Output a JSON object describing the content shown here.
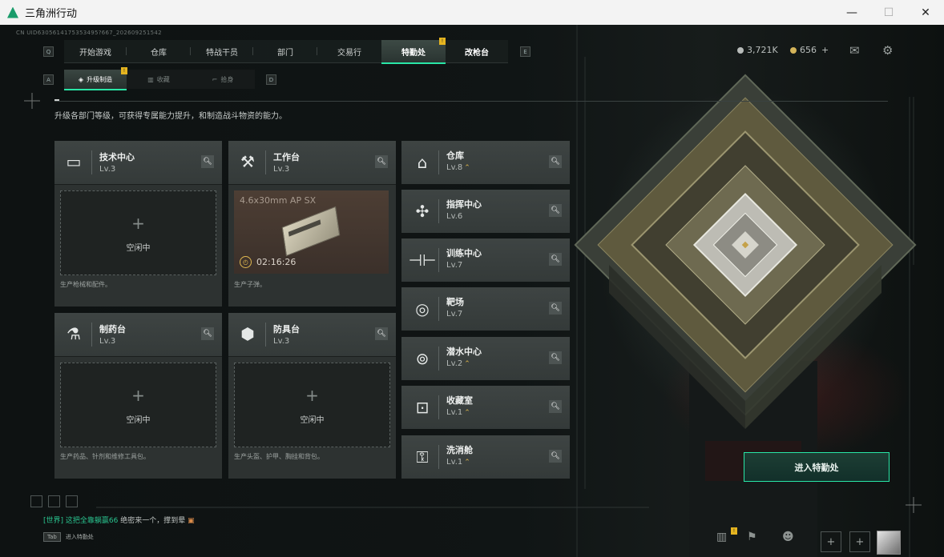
{
  "window": {
    "title": "三角洲行动",
    "minimize": "—",
    "maximize": "☐",
    "close": "✕"
  },
  "uid": "CN UID6305614175353495?667_202609251542",
  "nav": {
    "left_key": "Q",
    "right_key": "E",
    "tabs": [
      {
        "label": "开始游戏",
        "width": 78
      },
      {
        "label": "仓库",
        "width": 80
      },
      {
        "label": "特战干员",
        "width": 78
      },
      {
        "label": "部门",
        "width": 80
      },
      {
        "label": "交易行",
        "width": 80
      },
      {
        "label": "特勤处",
        "width": 80
      },
      {
        "label": "改枪台",
        "width": 78
      }
    ]
  },
  "currency": {
    "coins": "3,721K",
    "tokens": "656",
    "add": "+"
  },
  "subnav": {
    "left_key": "A",
    "right_key": "D",
    "tabs": [
      {
        "label": "升级制造",
        "icon": "◈"
      },
      {
        "label": "收藏",
        "icon": "▥"
      },
      {
        "label": "拾身",
        "icon": "⌐"
      }
    ]
  },
  "description": "升级各部门等级，可获得专属能力提升，和制造战斗物资的能力。",
  "stations": [
    {
      "name": "技术中心",
      "level": "Lv.3",
      "icon": "tech-center-icon",
      "glyph": "▭",
      "status": "空闲中",
      "footer": "生产枪械和配件。"
    },
    {
      "name": "工作台",
      "level": "Lv.3",
      "icon": "workbench-icon",
      "glyph": "⚒",
      "footer": "生产子弹。",
      "production": {
        "item": "4.6x30mm AP SX",
        "timer": "02:16:26"
      }
    },
    {
      "name": "制药台",
      "level": "Lv.3",
      "icon": "pharmacy-icon",
      "glyph": "⚗",
      "status": "空闲中",
      "footer": "生产药品、针剂和维修工具包。"
    },
    {
      "name": "防具台",
      "level": "Lv.3",
      "icon": "armor-bench-icon",
      "glyph": "⬢",
      "status": "空闲中",
      "footer": "生产头盔、护甲、胸挂和背包。"
    }
  ],
  "facilities": [
    {
      "name": "仓库",
      "level": "Lv.8",
      "upgrade": "⌃",
      "icon": "warehouse-icon",
      "glyph": "⌂"
    },
    {
      "name": "指挥中心",
      "level": "Lv.6",
      "upgrade": "",
      "icon": "command-center-icon",
      "glyph": "✣"
    },
    {
      "name": "训练中心",
      "level": "Lv.7",
      "upgrade": "",
      "icon": "training-center-icon",
      "glyph": "⊣⊢"
    },
    {
      "name": "靶场",
      "level": "Lv.7",
      "upgrade": "",
      "icon": "shooting-range-icon",
      "glyph": "◎"
    },
    {
      "name": "潜水中心",
      "level": "Lv.2",
      "upgrade": "⌃",
      "icon": "diving-center-icon",
      "glyph": "⊚"
    },
    {
      "name": "收藏室",
      "level": "Lv.1",
      "upgrade": "⌃",
      "icon": "collection-room-icon",
      "glyph": "⊡"
    },
    {
      "name": "洗消舱",
      "level": "Lv.1",
      "upgrade": "⌃",
      "icon": "decon-chamber-icon",
      "glyph": "⚿"
    }
  ],
  "enter_button": "进入特勤处",
  "chat": {
    "channel": "[世界]",
    "sender": "这把全靠躺赢66",
    "message": "绝密来一个，撑到晕"
  },
  "tab_hint": {
    "key": "Tab",
    "label": "进入特勤处"
  },
  "badge": "!"
}
